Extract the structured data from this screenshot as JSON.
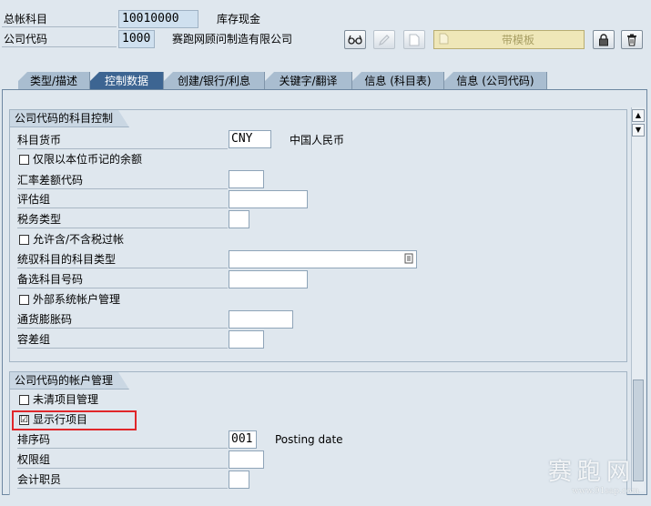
{
  "header": {
    "gl_account_label": "总帐科目",
    "gl_account_value": "10010000",
    "gl_account_desc": "库存现金",
    "company_code_label": "公司代码",
    "company_code_value": "1000",
    "company_code_desc": "赛跑网顾问制造有限公司",
    "template_button": "带模板"
  },
  "tabs": [
    {
      "label": "类型/描述"
    },
    {
      "label": "控制数据"
    },
    {
      "label": "创建/银行/利息"
    },
    {
      "label": "关键字/翻译"
    },
    {
      "label": "信息 (科目表)"
    },
    {
      "label": "信息 (公司代码)"
    }
  ],
  "group_control": {
    "title": "公司代码的科目控制",
    "currency_label": "科目货币",
    "currency_value": "CNY",
    "currency_desc": "中国人民币",
    "local_currency_only": "仅限以本位币记的余额",
    "exchange_diff_label": "汇率差额代码",
    "valuation_group_label": "评估组",
    "tax_category_label": "税务类型",
    "post_without_tax": "允许含/不含税过帐",
    "recon_account_label": "统驭科目的科目类型",
    "alt_account_label": "备选科目号码",
    "external_mgmt": "外部系统帐户管理",
    "inflation_key_label": "通货膨胀码",
    "tolerance_group_label": "容差组"
  },
  "group_account_mgmt": {
    "title": "公司代码的帐户管理",
    "open_item_mgmt": "未清项目管理",
    "line_item_display": "显示行项目",
    "line_item_display_checked": "☑",
    "sort_key_label": "排序码",
    "sort_key_value": "001",
    "sort_key_desc": "Posting date",
    "auth_group_label": "权限组",
    "accounting_clerk_label": "会计职员"
  },
  "watermark": {
    "main": "赛跑网",
    "sub": "www.91sap.com"
  }
}
